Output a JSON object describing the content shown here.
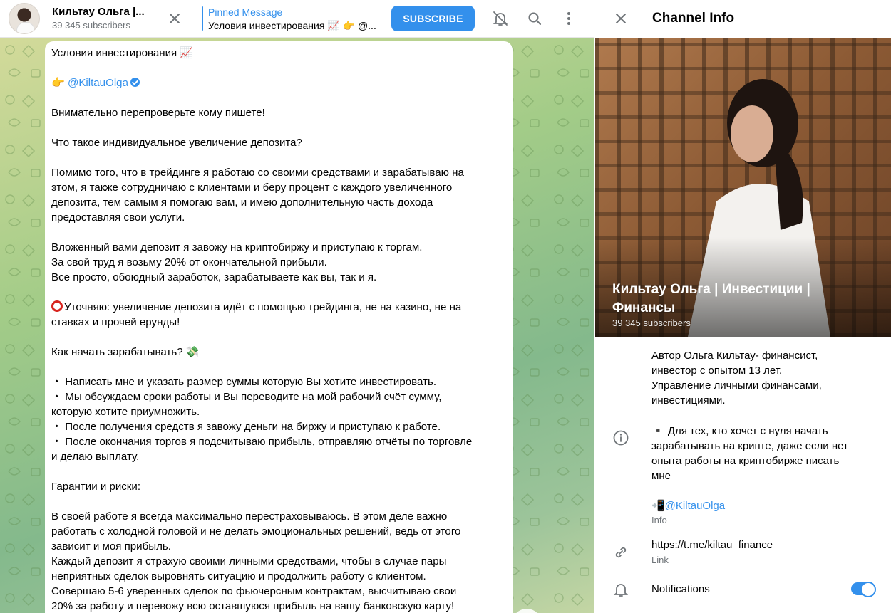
{
  "header": {
    "channel_title": "Кильтау Ольга |...",
    "subscribers": "39 345 subscribers",
    "pinned_label": "Pinned Message",
    "pinned_text": "Условия инвестирования 📈 👉 @...",
    "subscribe_label": "SUBSCRIBE"
  },
  "message": {
    "lines": [
      "Условия инвестирования 📈",
      "",
      "__MENTION__",
      "",
      "Внимательно перепроверьте кому пишете!",
      "",
      "Что такое индивидуальное увеличение депозита?",
      "",
      "Помимо того, что в трейдинге я работаю со своими средствами и зарабатываю на",
      "этом, я также сотрудничаю с клиентами и беру процент с каждого увеличенного",
      "депозита, тем самым я помогаю вам, и имею дополнительную часть дохода",
      "предоставляя свои услуги.",
      "",
      "Вложенный вами депозит я завожу на криптобиржу и приступаю к торгам.",
      "За свой труд я возьму 20% от окончательной прибыли.",
      "Все просто, обоюдный заработок, зарабатываете как вы, так и я.",
      "",
      "__WARN__",
      "ставках и прочей ерунды!",
      "",
      "Как начать зарабатывать? 💸",
      "",
      "・ Написать мне и указать размер суммы которую Вы хотите инвестировать.",
      "・ Мы обсуждаем сроки работы и Вы переводите на мой рабочий счёт сумму,",
      "которую хотите приумножить.",
      "・ После получения средств я завожу деньги на биржу и приступаю к работе.",
      "・ После окончания торгов я подсчитываю прибыль, отправляю отчёты по торговле",
      "и делаю выплату.",
      "",
      "Гарантии и риски:",
      "",
      "В своей работе я всегда максимально перестраховываюсь. В этом деле важно",
      "работать с холодной головой и не делать эмоциональных решений, ведь от этого",
      "зависит и моя прибыль.",
      "Каждый депозит я страхую своими личными средствами, чтобы в случае пары",
      "неприятных сделок выровнять ситуацию и продолжить работу с клиентом.",
      "Совершаю 5-6 уверенных сделок по фьючерсным контрактам, высчитываю свои",
      "20% за работу и перевожу всю оставшуюся прибыль на вашу банковскую карту!"
    ],
    "mention_prefix": "👉 ",
    "mention": "@KiltauOlga",
    "warning": "Уточняю: увеличение депозита идёт с помощью трейдинга, не на казино, не на"
  },
  "info": {
    "title": "Channel Info",
    "name": "Кильтау Ольга | Инвестиции | Финансы",
    "subscribers": "39 345 subscribers",
    "description_1": "Автор Ольга Кильтау- финансист,\nинвестор с опытом 13 лет.\nУправление личными финансами,\nинвестициями.",
    "description_2": "▪️ Для тех, кто хочет с нуля начать\nзарабатывать на крипте, даже если нет\nопыта работы на криптобирже писать\nмне",
    "contact": "📲@KiltauOlga",
    "info_caption": "Info",
    "link": "https://t.me/kiltau_finance",
    "link_caption": "Link",
    "notifications_label": "Notifications",
    "notifications_enabled": true
  },
  "colors": {
    "accent": "#3390ec",
    "muted": "#707579",
    "warning_ring": "#d8241e"
  }
}
